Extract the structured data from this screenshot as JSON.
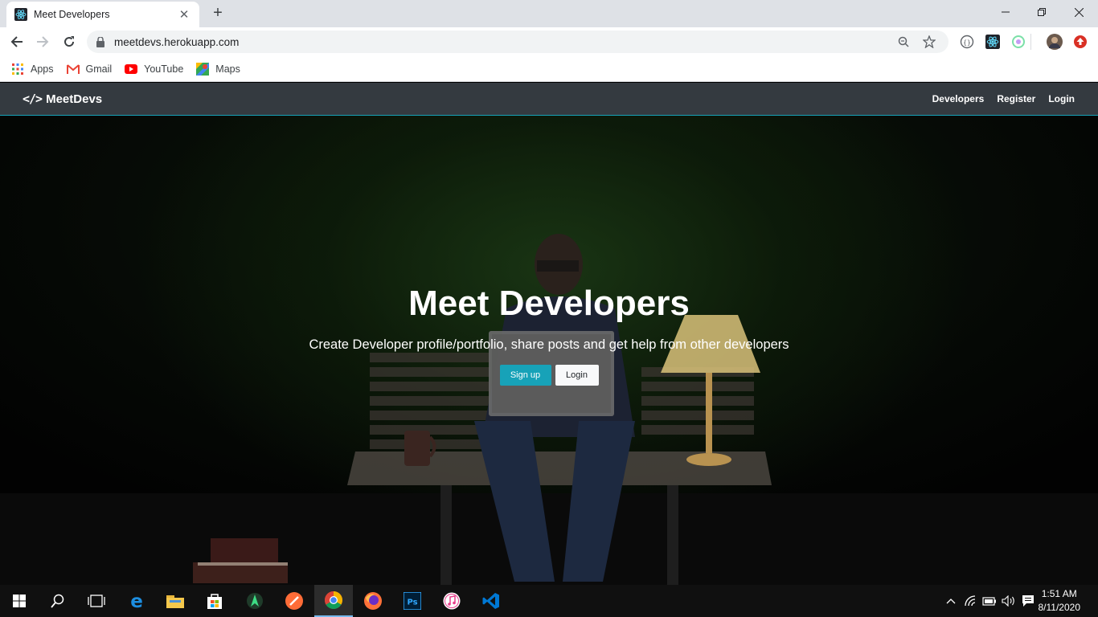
{
  "browser": {
    "tab_title": "Meet Developers",
    "url": "meetdevs.herokuapp.com",
    "bookmarks": [
      {
        "label": "Apps",
        "icon": "apps-grid-icon"
      },
      {
        "label": "Gmail",
        "icon": "gmail-icon"
      },
      {
        "label": "YouTube",
        "icon": "youtube-icon"
      },
      {
        "label": "Maps",
        "icon": "maps-icon"
      }
    ]
  },
  "site": {
    "brand": "MeetDevs",
    "brand_icon": "</>",
    "nav": {
      "developers": "Developers",
      "register": "Register",
      "login": "Login"
    }
  },
  "landing": {
    "title": "Meet Developers",
    "lead": "Create Developer profile/portfolio, share posts and get help from other developers",
    "signup_label": "Sign up",
    "login_label": "Login"
  },
  "taskbar": {
    "time": "1:51 AM",
    "date": "8/11/2020",
    "apps": [
      "windows-start-icon",
      "search-icon",
      "task-view-icon",
      "edge-icon",
      "file-explorer-icon",
      "store-icon",
      "android-studio-icon",
      "postman-icon",
      "chrome-icon",
      "firefox-icon",
      "photoshop-icon",
      "itunes-icon",
      "vscode-icon"
    ]
  },
  "colors": {
    "accent": "#17a2b8",
    "navbar": "#343a40",
    "taskbar": "#101010"
  }
}
